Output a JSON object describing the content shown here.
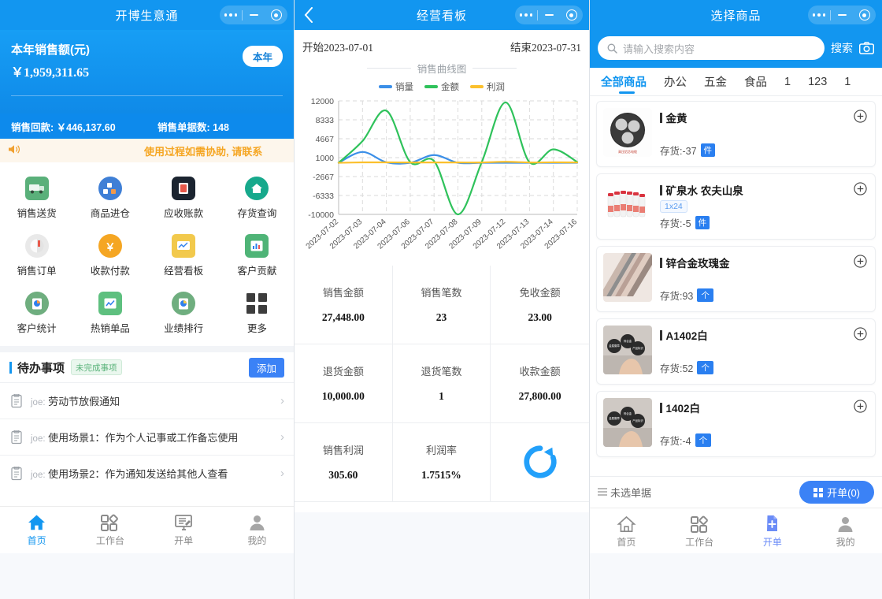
{
  "windows": {
    "home": {
      "title": "开博生意通",
      "hero": {
        "label": "本年销售额(元)",
        "amount": "￥1,959,311.65",
        "period_chip": "本年"
      },
      "substats": {
        "receipt_label": "销售回款: ￥446,137.60",
        "orders_label": "销售单据数: 148"
      },
      "notice": "使用过程如需协助, 请联系",
      "apps": [
        {
          "label": "销售送货",
          "icon": "truck-icon",
          "color": "#5ab07a"
        },
        {
          "label": "商品进仓",
          "icon": "boxes-icon",
          "color": "#3f7fd6"
        },
        {
          "label": "应收账款",
          "icon": "book-icon",
          "color": "#1b2430"
        },
        {
          "label": "存货查询",
          "icon": "home-icon",
          "color": "#17a98c"
        },
        {
          "label": "销售订单",
          "icon": "order-icon",
          "color": "#d8d8d8"
        },
        {
          "label": "收款付款",
          "icon": "yuan-icon",
          "color": "#f5a623"
        },
        {
          "label": "经营看板",
          "icon": "dashboard-icon",
          "color": "#f2c94c"
        },
        {
          "label": "客户贡献",
          "icon": "chart-icon",
          "color": "#4fb477"
        },
        {
          "label": "客户统计",
          "icon": "stats-icon",
          "color": "#6fae7f"
        },
        {
          "label": "热销单品",
          "icon": "hot-icon",
          "color": "#5ec07f"
        },
        {
          "label": "业绩排行",
          "icon": "rank-icon",
          "color": "#6fae7f"
        },
        {
          "label": "更多",
          "icon": "grid-icon",
          "color": "#3d3d3d"
        }
      ],
      "todo": {
        "title": "待办事项",
        "badge": "未完成事项",
        "add_label": "添加",
        "items": [
          {
            "who": "joe:",
            "text": "劳动节放假通知"
          },
          {
            "who": "joe:",
            "text": "使用场景1：作为个人记事或工作备忘使用"
          },
          {
            "who": "joe:",
            "text": "使用场景2：作为通知发送给其他人查看"
          }
        ]
      },
      "tabs": [
        {
          "label": "首页",
          "icon": "home-icon",
          "active": true
        },
        {
          "label": "工作台",
          "icon": "workbench-icon",
          "active": false
        },
        {
          "label": "开单",
          "icon": "billing-icon",
          "active": false
        },
        {
          "label": "我的",
          "icon": "user-icon",
          "active": false
        }
      ]
    },
    "dashboard": {
      "title": "经营看板",
      "back_icon": "chevron-left-icon",
      "date_start": "开始2023-07-01",
      "date_end": "结束2023-07-31",
      "chart_heading": "销售曲线图",
      "stats": [
        {
          "label": "销售金额",
          "value": "27,448.00"
        },
        {
          "label": "销售笔数",
          "value": "23"
        },
        {
          "label": "免收金额",
          "value": "23.00"
        },
        {
          "label": "退货金额",
          "value": "10,000.00"
        },
        {
          "label": "退货笔数",
          "value": "1"
        },
        {
          "label": "收款金额",
          "value": "27,800.00"
        },
        {
          "label": "销售利润",
          "value": "305.60"
        },
        {
          "label": "利润率",
          "value": "1.7515%"
        },
        {
          "label": "",
          "value": ""
        }
      ],
      "refresh_icon": "refresh-icon"
    },
    "goods": {
      "title": "选择商品",
      "search": {
        "placeholder": "请输入搜索内容",
        "button_label": "搜索",
        "search_icon": "search-icon",
        "camera_icon": "camera-icon"
      },
      "categories": [
        {
          "label": "全部商品",
          "selected": true
        },
        {
          "label": "办公",
          "selected": false
        },
        {
          "label": "五金",
          "selected": false
        },
        {
          "label": "食品",
          "selected": false
        },
        {
          "label": "1",
          "selected": false
        },
        {
          "label": "123",
          "selected": false
        },
        {
          "label": "1",
          "selected": false
        }
      ],
      "products": [
        {
          "name": "金黄",
          "spec": "",
          "stock_label": "存货:-37",
          "unit": "件",
          "unit_type": "text",
          "thumb": "cable-photo"
        },
        {
          "name": "矿泉水 农夫山泉",
          "spec": "1x24",
          "stock_label": "存货:-5",
          "unit": "件",
          "unit_type": "text",
          "thumb": "water-photo"
        },
        {
          "name": "锌合金玫瑰金",
          "spec": "",
          "stock_label": "存货:93",
          "unit": "个",
          "unit_type": "text",
          "thumb": "metal-photo"
        },
        {
          "name": "A1402白",
          "spec": "",
          "stock_label": "存货:52",
          "unit": "个",
          "unit_type": "text",
          "thumb": "badge-photo"
        },
        {
          "name": "1402白",
          "spec": "",
          "stock_label": "存货:-4",
          "unit": "个",
          "unit_type": "text",
          "thumb": "badge-photo"
        }
      ],
      "cart": {
        "text": "未选单据",
        "list_icon": "list-icon",
        "button_label": "开单(0)",
        "button_icon": "grid-small-icon"
      },
      "tabs": [
        {
          "label": "首页",
          "icon": "home-icon",
          "active": false
        },
        {
          "label": "工作台",
          "icon": "workbench-icon",
          "active": false
        },
        {
          "label": "开单",
          "icon": "billing-icon",
          "active": true
        },
        {
          "label": "我的",
          "icon": "user-icon",
          "active": false
        }
      ]
    }
  },
  "chart_data": {
    "type": "line",
    "title": "销售曲线图",
    "xlabel": "",
    "ylabel": "",
    "ylim": [
      -10000,
      12000
    ],
    "yticks": [
      12000,
      8333,
      4667,
      1000,
      -2667,
      -6333,
      -10000
    ],
    "grid": true,
    "legend_position": "top",
    "categories": [
      "2023-07-02",
      "2023-07-03",
      "2023-07-04",
      "2023-07-06",
      "2023-07-07",
      "2023-07-08",
      "2023-07-09",
      "2023-07-12",
      "2023-07-13",
      "2023-07-14",
      "2023-07-16"
    ],
    "series": [
      {
        "name": "销量",
        "color": "#3b8fe8",
        "values": [
          0,
          2100,
          100,
          0,
          1500,
          0,
          0,
          0,
          0,
          0,
          0
        ]
      },
      {
        "name": "金额",
        "color": "#2fc25b",
        "values": [
          0,
          4200,
          10100,
          150,
          330,
          -10000,
          150,
          11700,
          100,
          2600,
          150
        ]
      },
      {
        "name": "利润",
        "color": "#fbc02d",
        "values": [
          0,
          80,
          80,
          60,
          60,
          60,
          60,
          200,
          60,
          90,
          60
        ]
      }
    ]
  }
}
